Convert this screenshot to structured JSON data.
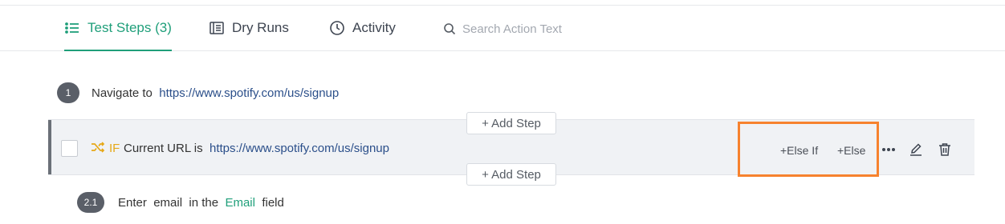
{
  "tabs": {
    "test_steps": "Test Steps (3)",
    "dry_runs": "Dry Runs",
    "activity": "Activity"
  },
  "search": {
    "placeholder": "Search Action Text"
  },
  "steps": {
    "step1": {
      "number": "1",
      "action": "Navigate to",
      "url": "https://www.spotify.com/us/signup"
    },
    "step2": {
      "keyword": "IF",
      "condition": "Current URL is",
      "url": "https://www.spotify.com/us/signup",
      "else_if_label": "+Else If",
      "else_label": "+Else"
    },
    "step2_1": {
      "number": "2.1",
      "action": "Enter",
      "value": "email",
      "mid": "in the",
      "field": "Email",
      "suffix": "field"
    }
  },
  "add_step_label": "+ Add Step",
  "colors": {
    "accent": "#1f9f7a",
    "if_keyword": "#e6a817",
    "highlight": "#f7822e",
    "link": "#2b4f8a"
  },
  "icons": [
    "list-icon",
    "dry-runs-icon",
    "clock-icon",
    "search-icon",
    "shuffle-icon",
    "more-icon",
    "edit-icon",
    "trash-icon"
  ]
}
